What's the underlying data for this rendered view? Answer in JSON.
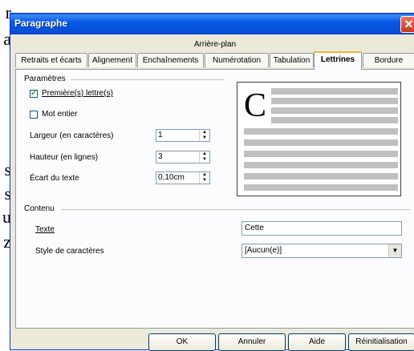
{
  "background_text": [
    "r",
    "a",
    "s",
    "s",
    "u",
    "z"
  ],
  "window": {
    "title": "Paragraphe",
    "close_glyph": "✕"
  },
  "tabs": {
    "row1": [
      "Arrière-plan"
    ],
    "row2": [
      "Retraits et écarts",
      "Alignement",
      "Enchaînements",
      "Numérotation",
      "Tabulation",
      "Lettrines",
      "Bordure"
    ],
    "active": "Lettrines"
  },
  "parametres": {
    "group_label": "Paramètres",
    "first_letters_label": "Première(s) lettre(s)",
    "first_letters_checked": true,
    "whole_word_label": "Mot entier",
    "whole_word_checked": false,
    "width_label": "Largeur (en caractères)",
    "width_value": "1",
    "height_label": "Hauteur (en lignes)",
    "height_value": "3",
    "spacing_label": "Écart du texte",
    "spacing_value": "0,10cm"
  },
  "preview": {
    "drop_letter": "C"
  },
  "contenu": {
    "group_label": "Contenu",
    "text_label": "Texte",
    "text_value": "Cette",
    "style_label": "Style de caractères",
    "style_value": "[Aucun(e)]"
  },
  "buttons": {
    "ok": "OK",
    "cancel": "Annuler",
    "help": "Aide",
    "reset": "Réinitialisation"
  }
}
